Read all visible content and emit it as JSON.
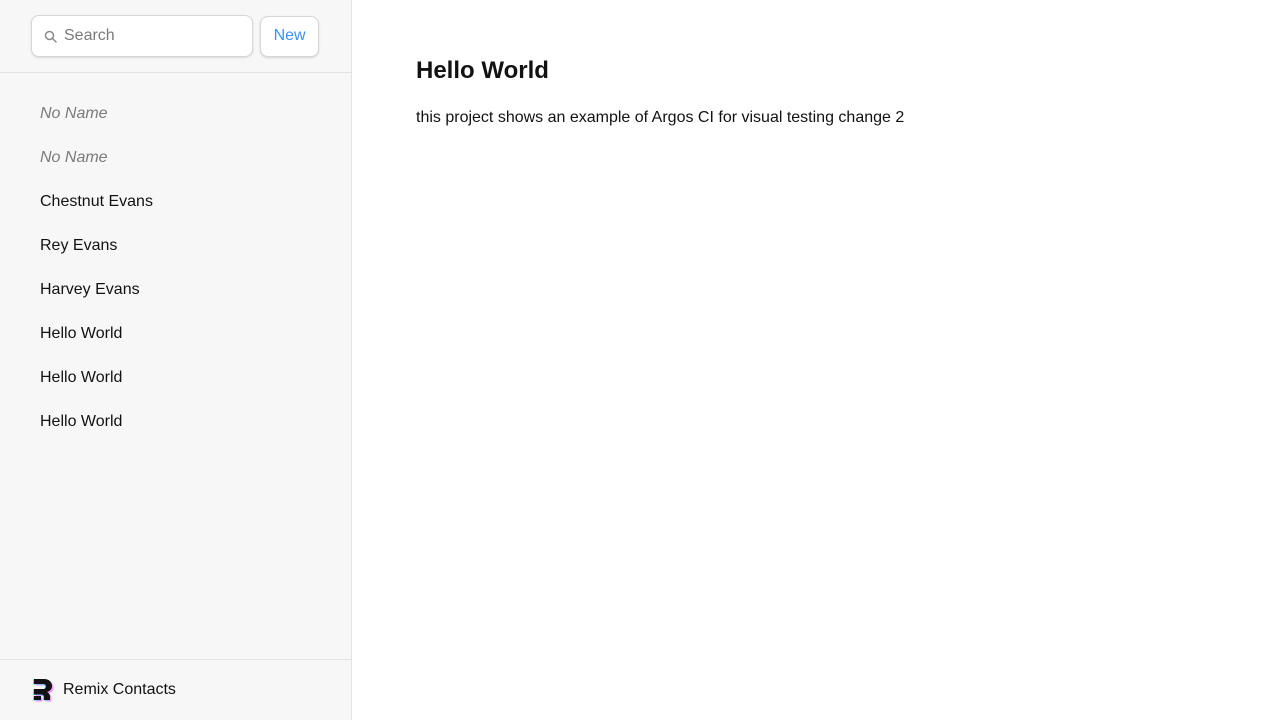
{
  "sidebar": {
    "search": {
      "placeholder": "Search",
      "value": ""
    },
    "new_label": "New",
    "contacts": [
      {
        "label": "No Name",
        "style": "no-name"
      },
      {
        "label": "No Name",
        "style": "no-name"
      },
      {
        "label": "Chestnut Evans",
        "style": "normal"
      },
      {
        "label": "Rey Evans",
        "style": "normal"
      },
      {
        "label": "Harvey Evans",
        "style": "normal"
      },
      {
        "label": "Hello World",
        "style": "normal"
      },
      {
        "label": "Hello World",
        "style": "normal"
      },
      {
        "label": "Hello World",
        "style": "normal"
      }
    ],
    "footer": {
      "title": "Remix Contacts",
      "logo_icon": "remix-logo-icon"
    }
  },
  "detail": {
    "name": "Hello World",
    "notes": "this project shows an example of Argos CI for visual testing change 2"
  },
  "colors": {
    "accent": "#3992ff",
    "sidebar_bg": "#f7f7f7",
    "muted_text": "#7a7a7a",
    "text": "#121212"
  }
}
